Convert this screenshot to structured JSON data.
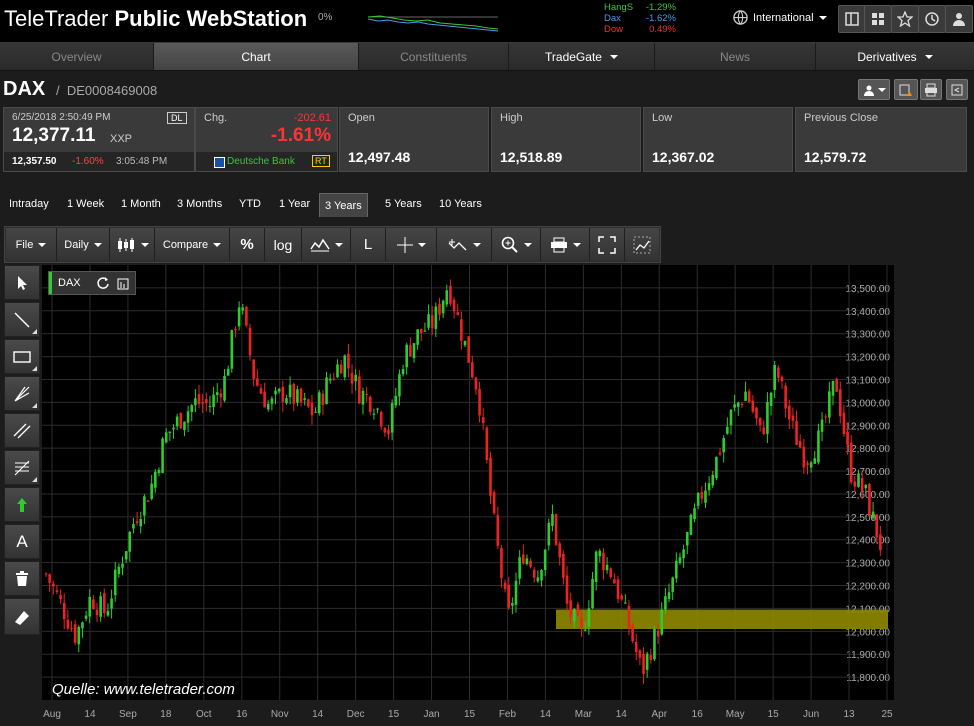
{
  "app": {
    "logo_light": "TeleTrader",
    "logo_bold": "Public WebStation"
  },
  "header": {
    "mini_pct": "0%",
    "tickers": [
      {
        "name": "HangS",
        "value": "-1.29%",
        "color": "#3ec43e"
      },
      {
        "name": "Dax",
        "value": "-1.62%",
        "color": "#4a9aee"
      },
      {
        "name": "Dow",
        "value": "0.49%",
        "color": "#ee3333"
      }
    ],
    "region": "International"
  },
  "nav": {
    "tabs": [
      "Overview",
      "Chart",
      "Constituents",
      "TradeGate",
      "News",
      "Derivatives"
    ],
    "active": "Chart"
  },
  "instrument": {
    "symbol": "DAX",
    "isin": "DE0008469008"
  },
  "quote": {
    "datetime": "6/25/2018 2:50:49 PM",
    "dl_badge": "DL",
    "last": "12,377.11",
    "unit": "XXP",
    "chg_label": "Chg.",
    "chg_abs": "-202.61",
    "chg_pct": "-1.61%",
    "bid_value": "12,357.50",
    "bid_pct": "-1.60%",
    "bid_time": "3:05:48 PM",
    "bank": "Deutsche Bank",
    "rt_badge": "RT",
    "stats": [
      {
        "label": "Open",
        "value": "12,497.48"
      },
      {
        "label": "High",
        "value": "12,518.89"
      },
      {
        "label": "Low",
        "value": "12,367.02"
      },
      {
        "label": "Previous Close",
        "value": "12,579.72"
      }
    ]
  },
  "ranges": [
    "Intraday",
    "1 Week",
    "1 Month",
    "3 Months",
    "YTD",
    "1 Year",
    "3 Years",
    "5 Years",
    "10 Years"
  ],
  "active_range": "3 Years",
  "toolbar": {
    "file": "File",
    "interval": "Daily",
    "compare": "Compare",
    "percent": "%",
    "log": "log",
    "l": "L"
  },
  "side_tools": [
    "pointer-icon",
    "line-icon",
    "rectangle-icon",
    "fan-icon",
    "channel-icon",
    "fibonacci-icon",
    "arrow-up-icon",
    "text-icon",
    "trash-icon",
    "eraser-icon"
  ],
  "chart_label": "DAX",
  "watermark": "Quelle: www.teletrader.com",
  "colors": {
    "up": "#2ecc2e",
    "down": "#ee2222",
    "band": "#8f8a00",
    "accent_red": "#ff3333"
  },
  "chart_data": {
    "type": "candlestick",
    "ylim": [
      11700,
      13600
    ],
    "yticks": [
      "11,800.00",
      "11,900.00",
      "12,000.00",
      "12,100.00",
      "12,200.00",
      "12,300.00",
      "12,400.00",
      "12,500.00",
      "12,600.00",
      "12,700.00",
      "12,800.00",
      "12,900.00",
      "13,000.00",
      "13,100.00",
      "13,200.00",
      "13,300.00",
      "13,400.00",
      "13,500.00"
    ],
    "xticks": [
      "Aug",
      "14",
      "Sep",
      "18",
      "Oct",
      "16",
      "Nov",
      "14",
      "Dec",
      "15",
      "Jan",
      "15",
      "Feb",
      "14",
      "Mar",
      "14",
      "Apr",
      "16",
      "May",
      "15",
      "Jun",
      "13",
      "25"
    ],
    "support_band": [
      12010,
      12095
    ],
    "close_path": [
      12250,
      12120,
      11980,
      12150,
      12080,
      12300,
      12500,
      12620,
      12850,
      12930,
      13000,
      12990,
      13100,
      13450,
      13100,
      12980,
      13050,
      13000,
      12950,
      13100,
      13200,
      13050,
      13000,
      12880,
      13200,
      13300,
      13350,
      13520,
      13280,
      13050,
      12500,
      12050,
      12350,
      12250,
      12500,
      12100,
      11980,
      12350,
      12250,
      12050,
      11820,
      12000,
      12200,
      12400,
      12600,
      12750,
      12950,
      13050,
      12850,
      13150,
      12900,
      12750,
      12850,
      13100,
      12700,
      12600,
      12380
    ]
  }
}
